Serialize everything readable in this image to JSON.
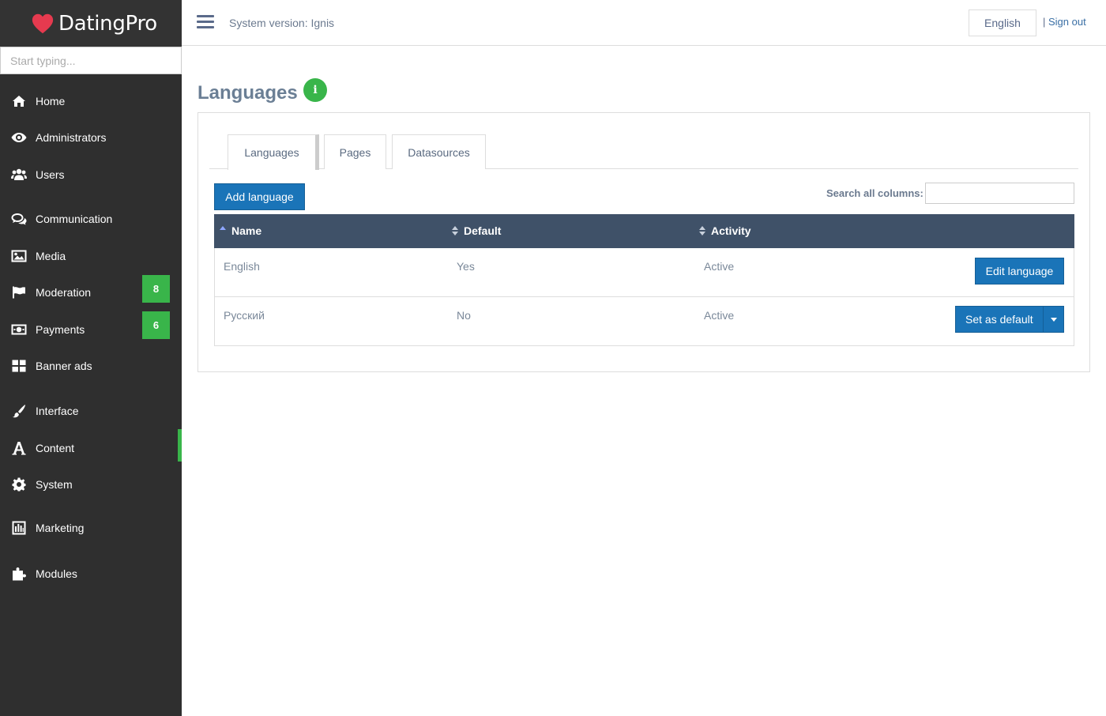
{
  "app": {
    "brand": "DatingPro",
    "search_placeholder": "Start typing..."
  },
  "sidebar": {
    "items": [
      {
        "label": "Home",
        "icon": "home-icon"
      },
      {
        "label": "Administrators",
        "icon": "eye-icon"
      },
      {
        "label": "Users",
        "icon": "users-icon"
      },
      {
        "label": "Communication",
        "icon": "chat-icon"
      },
      {
        "label": "Media",
        "icon": "image-icon"
      },
      {
        "label": "Moderation",
        "icon": "flag-icon",
        "badge": "8"
      },
      {
        "label": "Payments",
        "icon": "money-icon",
        "badge": "6"
      },
      {
        "label": "Banner ads",
        "icon": "grid-icon"
      },
      {
        "label": "Interface",
        "icon": "brush-icon"
      },
      {
        "label": "Content",
        "icon": "font-icon",
        "active": true
      },
      {
        "label": "System",
        "icon": "gear-icon"
      },
      {
        "label": "Marketing",
        "icon": "chart-icon"
      },
      {
        "label": "Modules",
        "icon": "puzzle-icon"
      }
    ],
    "badge_color": "#39b54a"
  },
  "header": {
    "system_version": "System version: Ignis",
    "language": "English",
    "separator": "|",
    "sign_out": "Sign out"
  },
  "main": {
    "title": "Languages",
    "tabs": [
      {
        "label": "Languages",
        "active": true
      },
      {
        "label": "Pages"
      },
      {
        "label": "Datasources"
      }
    ],
    "add_button": "Add language",
    "search_label": "Search all columns:",
    "search_value": "",
    "table": {
      "columns": [
        "Name",
        "Default",
        "Activity"
      ],
      "rows": [
        {
          "name": "English",
          "default": "Yes",
          "activity": "Active",
          "action": "Edit language"
        },
        {
          "name": "Русский",
          "default": "No",
          "activity": "Active",
          "action": "Set as default"
        }
      ]
    }
  },
  "colors": {
    "sidebar_bg": "#2f2f2f",
    "accent_green": "#39b54a",
    "primary_blue": "#1a74b8",
    "table_header": "#3f5168"
  }
}
